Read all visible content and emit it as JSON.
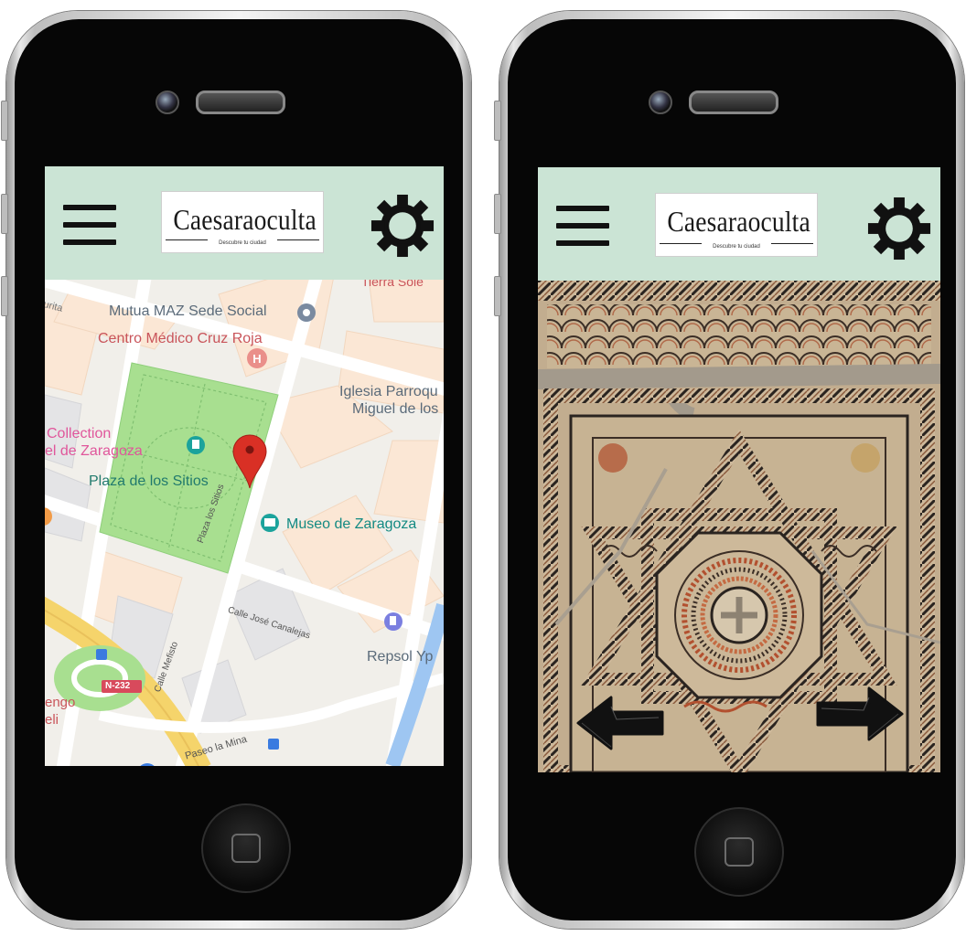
{
  "app": {
    "logo_title": "Caesaraoculta",
    "logo_subtitle": "Descubre tu ciudad"
  },
  "icons": {
    "menu": "hamburger-menu-icon",
    "settings": "gear-icon",
    "map_pin": "red-map-pin-icon",
    "prev": "left-arrow-icon",
    "next": "right-arrow-icon"
  },
  "colors": {
    "header_bg": "#cbe4d5",
    "pin": "#d93025",
    "park": "#a8df90",
    "road_yellow": "#f5d46b",
    "museum_teal": "#1ba39c"
  },
  "map": {
    "labels": {
      "mutua": "Mutua MAZ Sede Social",
      "centro": "Centro Médico Cruz Roja",
      "iglesia1": "Iglesia Parroqu",
      "iglesia2": "Miguel de los",
      "collection1": "Collection",
      "collection2": "el de Zaragoza",
      "plaza": "Plaza de los Sitios",
      "museo": "Museo de Zaragoza",
      "street_plaza": "Plaza los Sitios",
      "street_canalejas": "Calle José Canalejas",
      "street_mefisto": "Calle Mefisto",
      "repsol": "Repsol Yp",
      "n232": "N-232",
      "engo1": "engo",
      "engo2": "eli",
      "paseo": "Paseo la Mina",
      "rita": "urita",
      "hierro": "Tierra Sole"
    }
  }
}
